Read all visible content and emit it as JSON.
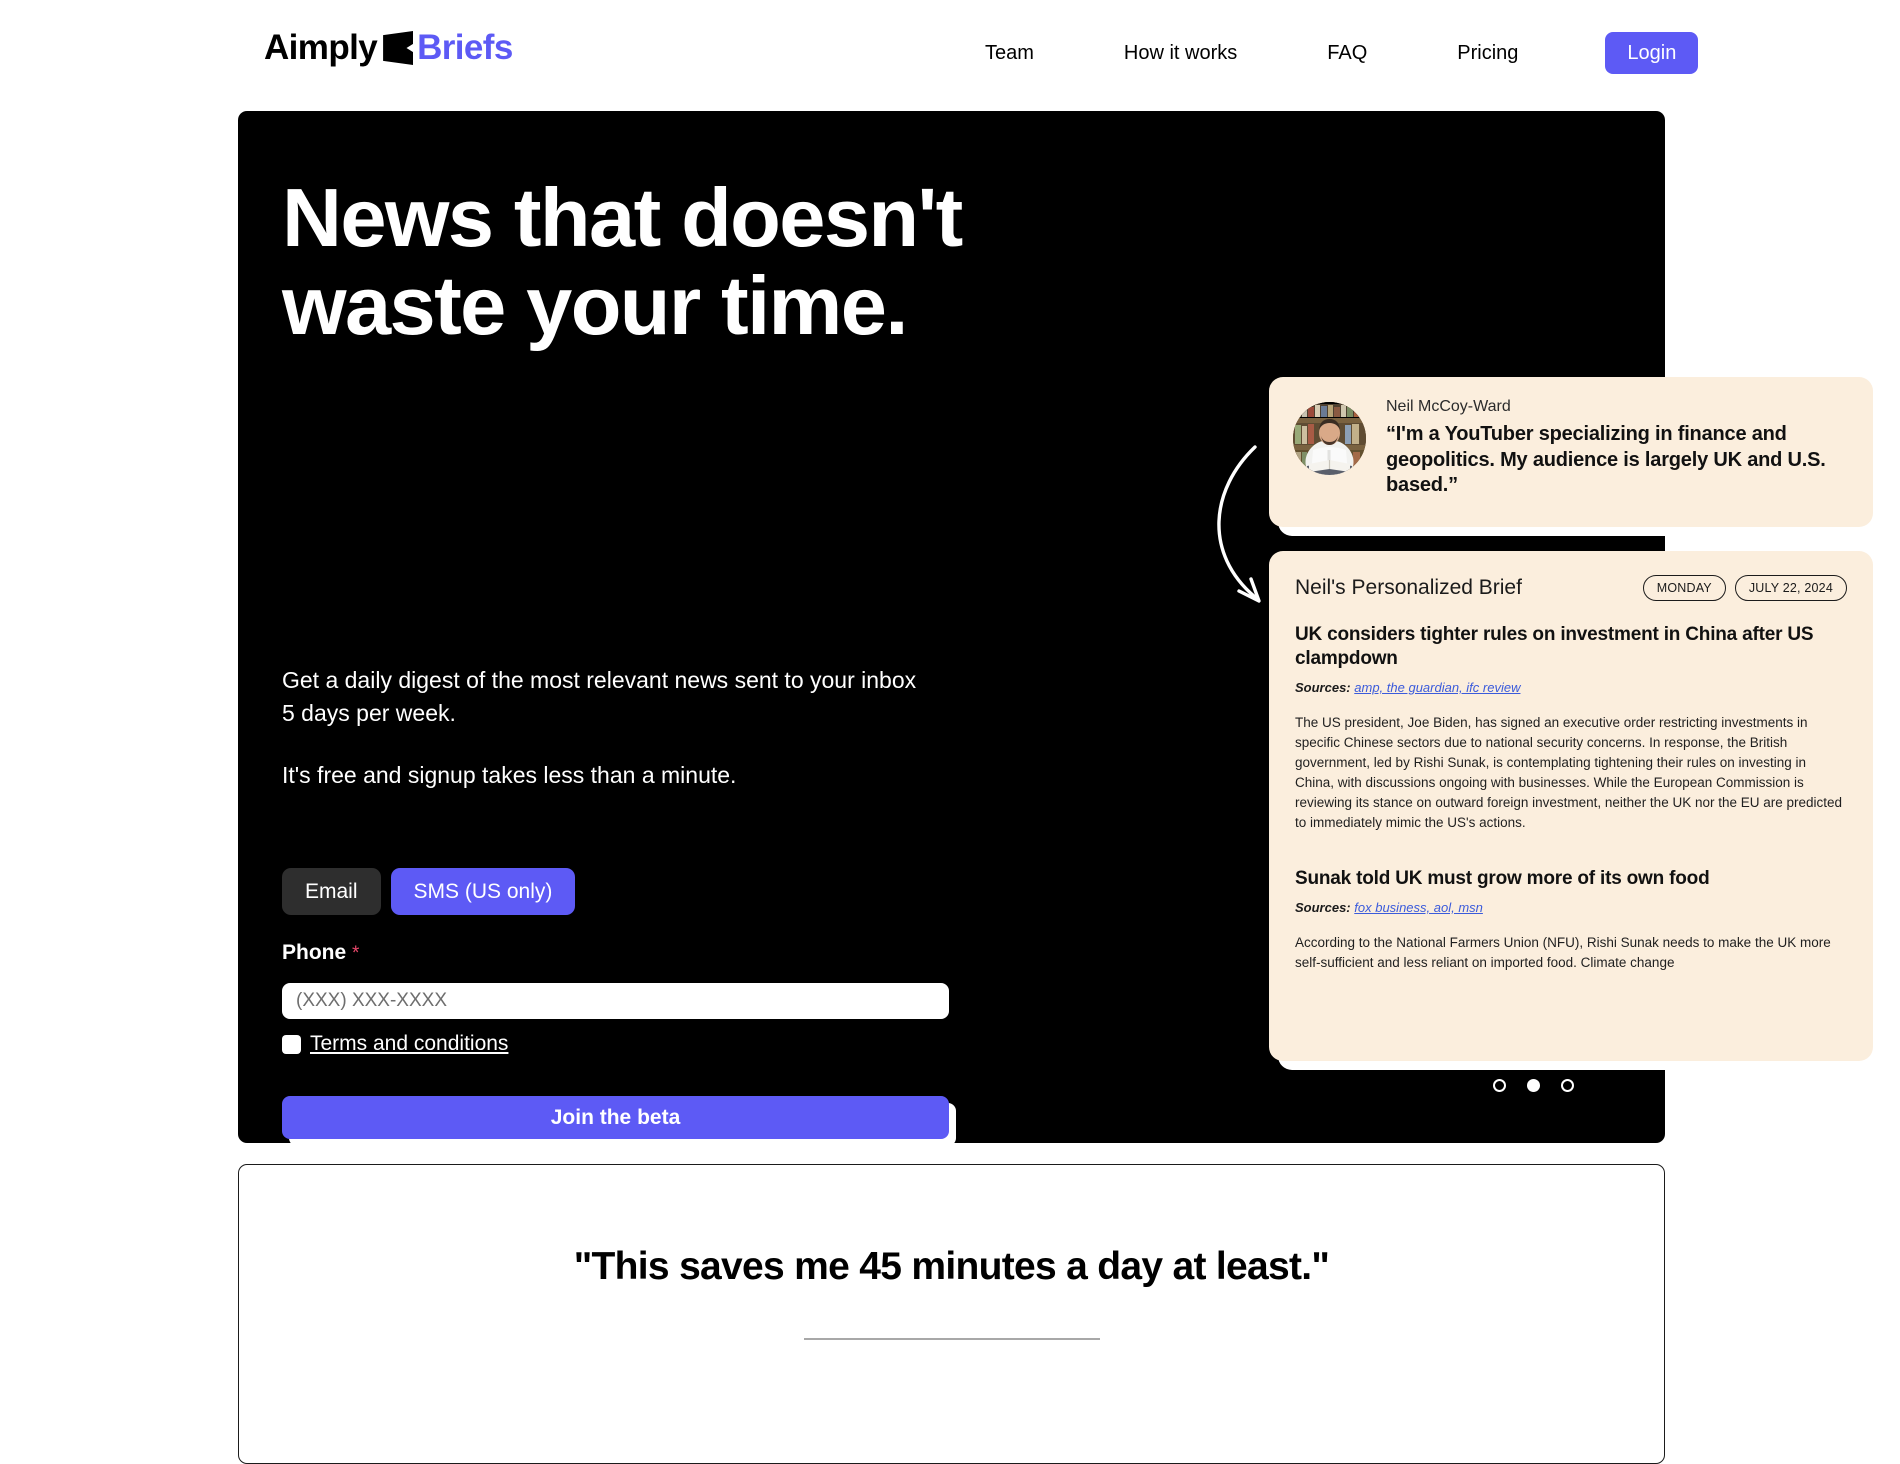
{
  "brand": {
    "name_part_1": "Aimply",
    "name_part_2": "Briefs",
    "accent_color": "#5d5af5"
  },
  "header": {
    "nav": [
      {
        "label": "Team"
      },
      {
        "label": "How it works"
      },
      {
        "label": "FAQ"
      },
      {
        "label": "Pricing"
      }
    ],
    "login_label": "Login"
  },
  "hero": {
    "title": "News that doesn't waste your time.",
    "subtitle_1": "Get a daily digest of the most relevant news sent to your inbox 5 days per week.",
    "subtitle_2": "It's free and signup takes less than a minute.",
    "channels": [
      {
        "label": "Email",
        "active": false
      },
      {
        "label": "SMS (US only)",
        "active": true
      }
    ],
    "phone_label": "Phone",
    "required_marker": "*",
    "phone_placeholder": "(XXX) XXX-XXXX",
    "phone_value": "",
    "terms_label": "Terms and conditions",
    "terms_checked": false,
    "submit_label": "Join the beta"
  },
  "testimonial": {
    "name": "Neil McCoy-Ward",
    "quote": "“I'm a YouTuber specializing in finance and geopolitics. My audience is largely UK and U.S. based.”"
  },
  "brief": {
    "title": "Neil's Personalized Brief",
    "badge_day": "MONDAY",
    "badge_date": "JULY 22, 2024",
    "sources_label": "Sources:",
    "articles": [
      {
        "headline": "UK considers tighter rules on investment in China after US clampdown",
        "sources": "amp, the guardian, ifc review",
        "body": "The US president, Joe Biden, has signed an executive order restricting investments in specific Chinese sectors due to national security concerns. In response, the British government, led by Rishi Sunak, is contemplating tightening their rules on investing in China, with discussions ongoing with businesses. While the European Commission is reviewing its stance on outward foreign investment, neither the UK nor the EU are predicted to immediately mimic the US's actions."
      },
      {
        "headline": "Sunak told UK must grow more of its own food",
        "sources": "fox business, aol, msn",
        "body": "According to the National Farmers Union (NFU), Rishi Sunak needs to make the UK more self-sufficient and less reliant on imported food. Climate change"
      }
    ],
    "carousel": {
      "total": 3,
      "active_index": 1
    }
  },
  "quote_section": {
    "quote": "\"This saves me 45 minutes a day at least.\""
  }
}
